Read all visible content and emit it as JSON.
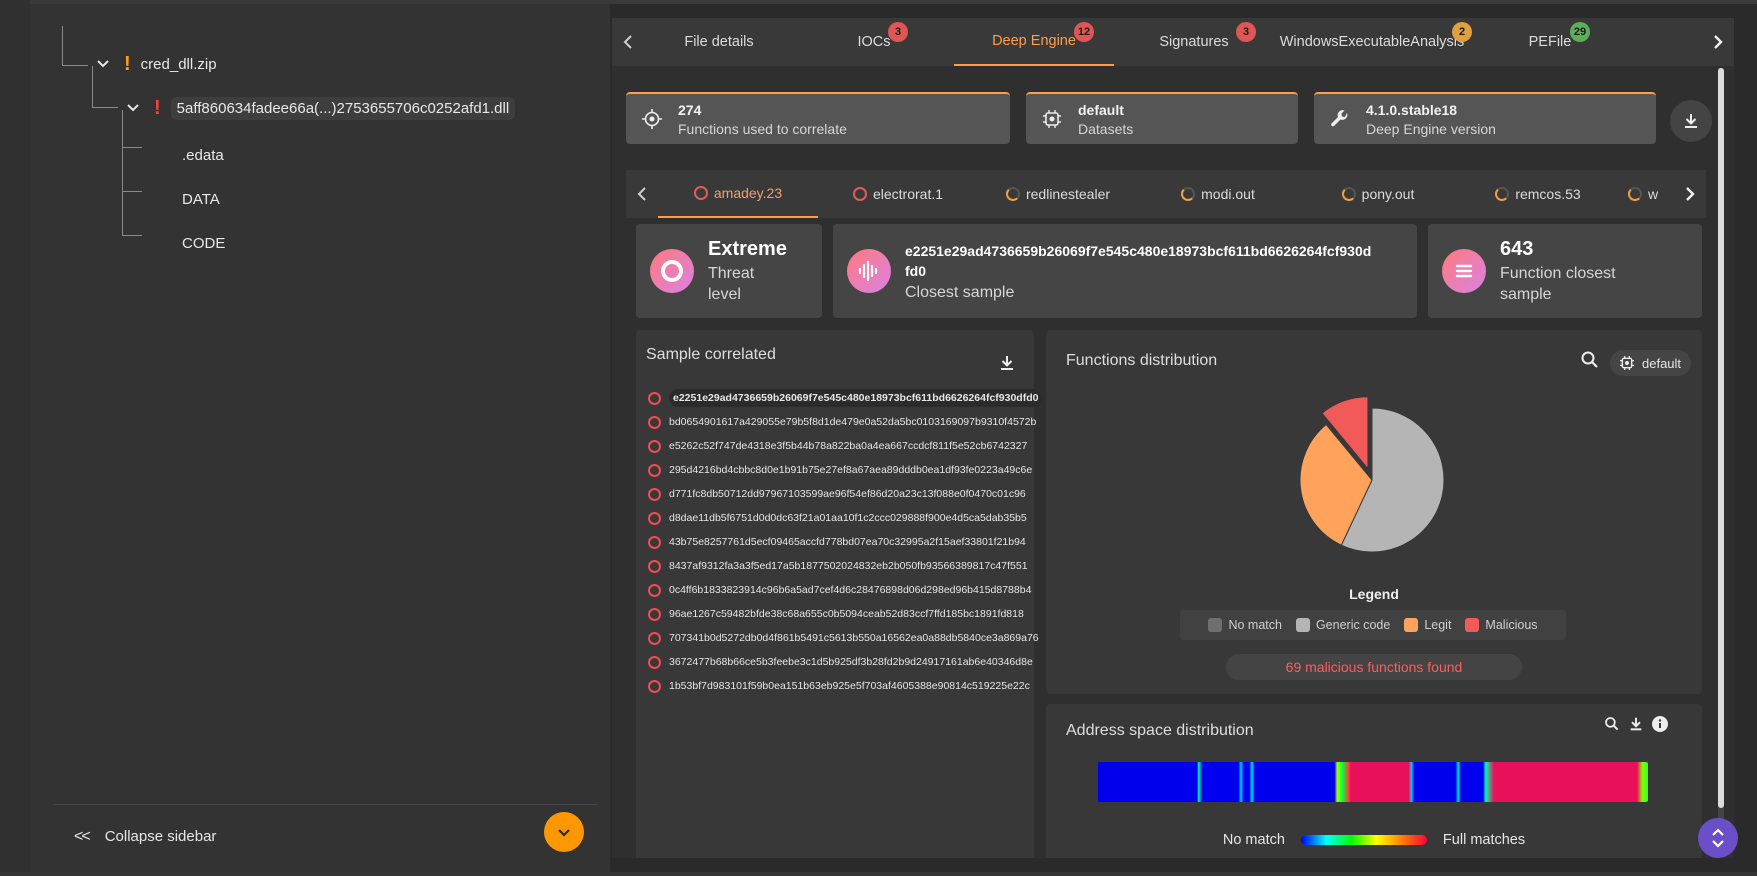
{
  "sidebar": {
    "tree": [
      {
        "label": "cred_dll.zip",
        "warn": "!"
      },
      {
        "label": "5aff860634fadee66a(...)2753655706c0252afd1.dll",
        "warn": "!"
      },
      {
        "label": ".edata"
      },
      {
        "label": "DATA"
      },
      {
        "label": "CODE"
      }
    ],
    "collapse_label": "Collapse sidebar"
  },
  "tabs": [
    {
      "label": "File details"
    },
    {
      "label": "IOCs",
      "badge": "3",
      "badge_color": "#e25555"
    },
    {
      "label": "Deep Engine",
      "badge": "12",
      "badge_color": "#e25555",
      "active": true
    },
    {
      "label": "Signatures",
      "badge": "3",
      "badge_color": "#e25555"
    },
    {
      "label": "WindowsExecutableAnalysis",
      "badge": "2",
      "badge_color": "#e0a040"
    },
    {
      "label": "PEFile",
      "badge": "29",
      "badge_color": "#5ab05a"
    }
  ],
  "info_cards": [
    {
      "value": "274",
      "label": "Functions used to correlate",
      "icon": "target-icon"
    },
    {
      "value": "default",
      "label": "Datasets",
      "icon": "dataset-icon"
    },
    {
      "value": "4.1.0.stable18",
      "label": "Deep Engine version",
      "icon": "wrench-icon"
    }
  ],
  "subtabs": [
    {
      "label": "amadey.23",
      "active": true,
      "full": true
    },
    {
      "label": "electrorat.1",
      "full": true
    },
    {
      "label": "redlinestealer"
    },
    {
      "label": "modi.out"
    },
    {
      "label": "pony.out"
    },
    {
      "label": "remcos.53"
    },
    {
      "label": "w"
    }
  ],
  "stats": {
    "threat_value": "Extreme",
    "threat_label_1": "Threat",
    "threat_label_2": "level",
    "closest_hash_1": "e2251e29ad4736659b26069f7e545c480e18973bcf611bd6626264fcf930d",
    "closest_hash_2": "fd0",
    "closest_label": "Closest sample",
    "func_value": "643",
    "func_label_1": "Function closest",
    "func_label_2": "sample"
  },
  "sample_correlated": {
    "title": "Sample correlated",
    "hashes": [
      "e2251e29ad4736659b26069f7e545c480e18973bcf611bd6626264fcf930dfd0",
      "bd0654901617a429055e79b5f8d1de479e0a52da5bc0103169097b9310f4572b",
      "e5262c52f747de4318e3f5b44b78a822ba0a4ea667ccdcf811f5e52cb6742327",
      "295d4216bd4cbbc8d0e1b91b75e27ef8a67aea89dddb0ea1df93fe0223a49c6e",
      "d771fc8db50712dd97967103599ae96f54ef86d20a23c13f088e0f0470c01c96",
      "d8dae11db5f6751d0d0dc63f21a01aa10f1c2ccc029888f900e4d5ca5dab35b5",
      "43b75e8257761d5ecf09465accfd778bd07ea70c32995a2f15aef33801f21b94",
      "8437af9312fa3a3f5ed17a5b1877502024832eb2b050fb93566389817c47f551",
      "0c4ff6b1833823914c96b6a5ad7cef4d6c28476898d06d298ed96b415d8788b4",
      "96ae1267c59482bfde38c68a655c0b5094ceab52d83ccf7ffd185bc1891fd818",
      "707341b0d5272db0d4f861b5491c5613b550a16562ea0a88db5840ce3a869a76",
      "3672477b68b66ce5b3feebe3c1d5b925df3b28fd2b9d24917161ab6e40346d8e",
      "1b53bf7d983101f59b0ea151b63eb925e5f703af4605388e90814c519225e22c"
    ]
  },
  "functions_distribution": {
    "title": "Functions distribution",
    "dataset_pill": "default",
    "legend_title": "Legend",
    "legend": [
      {
        "label": "No match",
        "color": "#6e6e6e"
      },
      {
        "label": "Generic code",
        "color": "#b5b5b5"
      },
      {
        "label": "Legit",
        "color": "#ffa35c"
      },
      {
        "label": "Malicious",
        "color": "#f25a5a"
      }
    ],
    "malicious_found": "69 malicious functions found"
  },
  "chart_data": {
    "type": "pie",
    "categories": [
      "No match",
      "Generic code",
      "Legit",
      "Malicious"
    ],
    "values": [
      0,
      57,
      32,
      11
    ],
    "colors": [
      "#6e6e6e",
      "#b5b5b5",
      "#ffa35c",
      "#f25a5a"
    ],
    "exploded": "Malicious"
  },
  "address_space": {
    "title": "Address space distribution",
    "legend_left": "No match",
    "legend_right": "Full matches"
  }
}
